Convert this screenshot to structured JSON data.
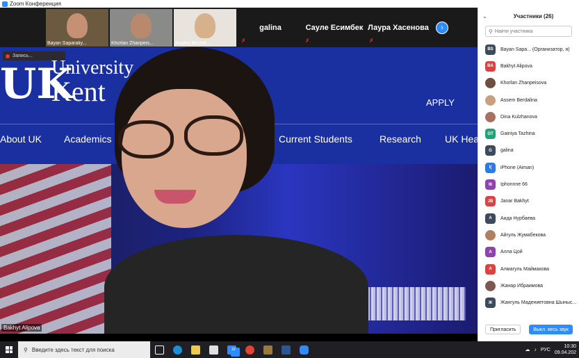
{
  "window": {
    "title": "Zoom Конференция"
  },
  "gallery": {
    "video_tiles": [
      {
        "name": "Bayan Saparaliy...",
        "face_color": "#c69074",
        "bg": "#6b5a40"
      },
      {
        "name": "Khorlan Zhanpeis...",
        "face_color": "#b9896d",
        "bg": "#8a8a88"
      },
      {
        "name": "Assem Berdali...",
        "face_color": "#d7b08c",
        "bg": "#e8e4dd"
      }
    ],
    "name_tiles": [
      "galina",
      "Сауле Есимбек",
      "Лаура Хасенова"
    ]
  },
  "recording": {
    "label": "Запись..."
  },
  "screen_share": {
    "banner": {
      "logo": "UK",
      "university": "University",
      "kent": "Kent",
      "apply": "APPLY"
    },
    "nav": [
      "About UK",
      "Academics",
      "Current Students",
      "Research",
      "UK Hea"
    ]
  },
  "active_speaker": {
    "name": "Bakhyt Alipova"
  },
  "participants": {
    "title": "Участники (26)",
    "search_placeholder": "Найти участника",
    "items": [
      {
        "initials": "BS",
        "color": "#3d4a5c",
        "name": "Bayan Sapa... (Организатор, я)"
      },
      {
        "initials": "BA",
        "color": "#d84343",
        "name": "Bakhyt Alipova"
      },
      {
        "initials": "",
        "color": "#6b5040",
        "name": "Khorlan Zhanpeisova",
        "photo": true
      },
      {
        "initials": "",
        "color": "#c8a080",
        "name": "Assem Berdalina",
        "photo": true
      },
      {
        "initials": "",
        "color": "#a87060",
        "name": "Dina Kulzhanova",
        "photo": true
      },
      {
        "initials": "GT",
        "color": "#26a07a",
        "name": "Gainiya Tazhina"
      },
      {
        "initials": "G",
        "color": "#3d4a5c",
        "name": "galina"
      },
      {
        "initials": "I(",
        "color": "#2c7be5",
        "name": "iPhone (Aiman)"
      },
      {
        "initials": "I6",
        "color": "#8e44ad",
        "name": "Iphonnne 66"
      },
      {
        "initials": "JB",
        "color": "#d84343",
        "name": "Janar Bakhyt"
      },
      {
        "initials": "А",
        "color": "#3d4a5c",
        "name": "Аида Нурбаева"
      },
      {
        "initials": "",
        "color": "#b08060",
        "name": "Айгуль Жумабекова",
        "photo": true
      },
      {
        "initials": "А",
        "color": "#8e44ad",
        "name": "Алла Цой"
      },
      {
        "initials": "А",
        "color": "#d84343",
        "name": "Алмагуль Маймакова"
      },
      {
        "initials": "",
        "color": "#7a5a50",
        "name": "Жанар Ибраимова",
        "photo": true
      },
      {
        "initials": "Ж",
        "color": "#3d4a5c",
        "name": "Жангуль Мадениетовна Шыныс..."
      }
    ],
    "invite_label": "Пригласить",
    "mute_all_label": "Выкл. весь звук"
  },
  "taskbar": {
    "search_placeholder": "Введите здесь текст для поиска",
    "mail_badge": "19",
    "language": "РУС",
    "time": "10:30",
    "date": "09.04.202"
  }
}
